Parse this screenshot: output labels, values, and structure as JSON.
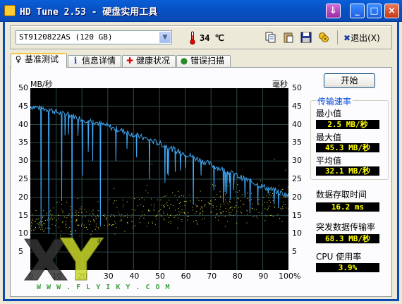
{
  "window": {
    "title": "HD Tune 2.53 - 硬盘实用工具",
    "buttons": {
      "download": "⇓",
      "minimize": "_",
      "maximize": "□",
      "close": "×"
    }
  },
  "toolbar": {
    "drive": "ST9120822AS  (120 GB)",
    "temperature": "34 ℃",
    "exit_label": "退出",
    "exit_shortcut": "(X)"
  },
  "tabs": [
    {
      "label": "基准测试",
      "icon": "benchmark-icon",
      "glyph": "♀",
      "active": true
    },
    {
      "label": "信息详情",
      "icon": "info-icon",
      "glyph": "i",
      "active": false
    },
    {
      "label": "健康状况",
      "icon": "health-cross-icon",
      "glyph": "✚",
      "active": false
    },
    {
      "label": "错误扫描",
      "icon": "magnifier-icon",
      "glyph": "●",
      "active": false
    }
  ],
  "chart_data": {
    "type": "line",
    "left_unit": "MB/秒",
    "right_unit": "毫秒",
    "y_ticks": [
      "50",
      "45",
      "40",
      "35",
      "30",
      "25",
      "20",
      "15",
      "10",
      "5"
    ],
    "right_ticks": [
      "50",
      "45",
      "40",
      "35",
      "30",
      "25",
      "20",
      "15",
      "10",
      "5"
    ],
    "x_ticks": [
      "0",
      "10",
      "20",
      "30",
      "40",
      "50",
      "60",
      "70",
      "80",
      "90",
      "100%"
    ],
    "xlim": [
      0,
      100
    ],
    "ylim": [
      0,
      50
    ],
    "grid": true,
    "series": [
      {
        "color": "#3fa9f5",
        "x": [
          0,
          2,
          4,
          6,
          8,
          10,
          12,
          14,
          16,
          18,
          20,
          22,
          24,
          26,
          28,
          30,
          32,
          34,
          36,
          38,
          40,
          42,
          44,
          46,
          48,
          50,
          52,
          54,
          56,
          58,
          60,
          62,
          64,
          66,
          68,
          70,
          72,
          74,
          76,
          78,
          80,
          82,
          84,
          86,
          88,
          90,
          92,
          94,
          96,
          98,
          100
        ],
        "y": [
          45,
          44.8,
          44.5,
          44.2,
          44,
          43.5,
          43,
          42.8,
          42.5,
          42,
          41.5,
          41.2,
          41,
          40.5,
          40,
          39.6,
          39,
          38.7,
          38.2,
          37.8,
          37.2,
          36.8,
          36.3,
          35.8,
          35.3,
          34.8,
          34.2,
          33.6,
          33,
          32.5,
          32,
          31.4,
          30.8,
          30.2,
          29.6,
          29,
          28.4,
          27.8,
          27.2,
          26.6,
          26,
          25.4,
          24.8,
          24.2,
          23.6,
          23,
          22.5,
          22,
          21.5,
          21,
          20.5
        ],
        "dips": [
          [
            4,
            12
          ],
          [
            7,
            10
          ],
          [
            12,
            19
          ],
          [
            16,
            8
          ],
          [
            20,
            26
          ],
          [
            24,
            30
          ],
          [
            27,
            12
          ],
          [
            33,
            30
          ],
          [
            41,
            31
          ],
          [
            46,
            25
          ],
          [
            52,
            24
          ],
          [
            56,
            27
          ],
          [
            60,
            28
          ],
          [
            63,
            18
          ],
          [
            66,
            26
          ],
          [
            71,
            22
          ],
          [
            77,
            24
          ],
          [
            83,
            20
          ],
          [
            88,
            18
          ],
          [
            92,
            21
          ],
          [
            96,
            17
          ]
        ]
      },
      {
        "color": "#e6e63c",
        "style": "scatter",
        "x_range": [
          0,
          100
        ],
        "y_range": [
          11,
          28
        ],
        "trend": "access time scatter roughly 12-20 ms"
      }
    ]
  },
  "side_panel": {
    "start_button": "开始",
    "transfer_group": "传输速率",
    "min_label": "最小值",
    "min_value": "2.5 MB/秒",
    "max_label": "最大值",
    "max_value": "45.3 MB/秒",
    "avg_label": "平均值",
    "avg_value": "32.1 MB/秒",
    "access_label": "数据存取时间",
    "access_value": "16.2 ms",
    "burst_label": "突发数据传输率",
    "burst_value": "68.3 MB/秒",
    "cpu_label": "CPU 使用率",
    "cpu_value": "3.9%"
  },
  "watermark": {
    "logo": "XY",
    "url": "W W W . F L Y I K Y . C O M"
  }
}
